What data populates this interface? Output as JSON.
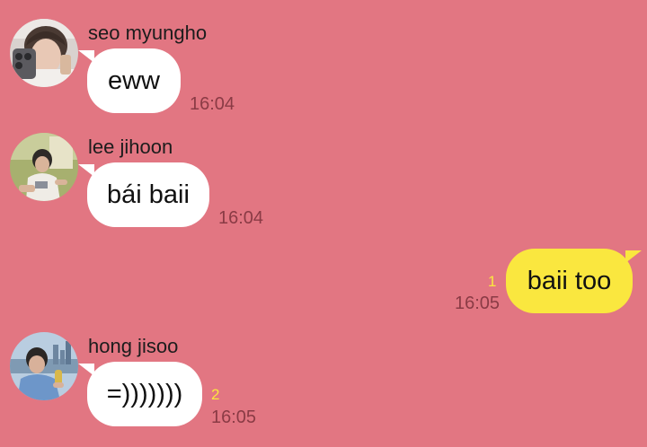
{
  "colors": {
    "background": "#e27682",
    "incoming_bubble": "#ffffff",
    "outgoing_bubble": "#fae73f",
    "unread_count": "#fae73f",
    "timestamp": "#8a3b45"
  },
  "messages": [
    {
      "sender": "seo myungho",
      "avatar": "profile-photo",
      "text": "eww",
      "time": "16:04",
      "direction": "incoming"
    },
    {
      "sender": "lee jihoon",
      "avatar": "profile-photo",
      "text": "bái baii",
      "time": "16:04",
      "direction": "incoming"
    },
    {
      "text": "baii too",
      "time": "16:05",
      "unread": "1",
      "direction": "outgoing"
    },
    {
      "sender": "hong jisoo",
      "avatar": "profile-photo",
      "text": "=)))))))",
      "time": "16:05",
      "unread": "2",
      "direction": "incoming"
    }
  ]
}
